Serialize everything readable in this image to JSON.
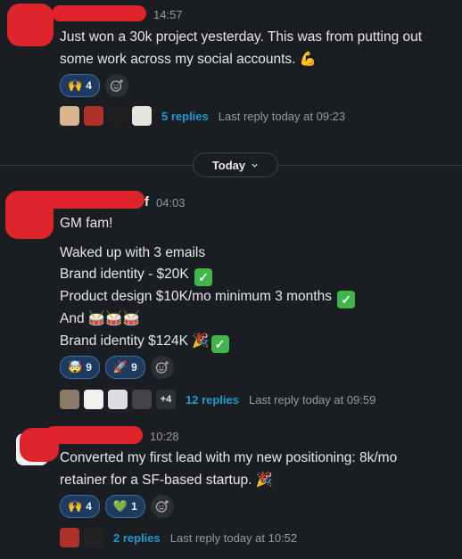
{
  "messages": [
    {
      "time": "14:57",
      "lines": [
        "Just won a 30k project yesterday. This was from putting out",
        "some work across my social accounts."
      ],
      "reactions": [
        {
          "emoji": "🙌",
          "count": "4"
        }
      ],
      "thread": {
        "replies": "5 replies",
        "last": "Last reply today at 09:23"
      }
    },
    {
      "name_fragment": "f",
      "time": "04:03",
      "lines": [
        "GM fam!",
        "",
        "Waked up with 3 emails",
        "Brand identity - $20K",
        "Product design $10K/mo minimum 3 months",
        "And",
        "Brand identity $124K"
      ],
      "reactions": [
        {
          "emoji": "🤯",
          "count": "9"
        },
        {
          "emoji": "🚀",
          "count": "9"
        }
      ],
      "thread": {
        "more": "+4",
        "replies": "12 replies",
        "last": "Last reply today at 09:59"
      }
    },
    {
      "time": "10:28",
      "lines": [
        "Converted my first lead with my new positioning: 8k/mo",
        "retainer for a SF-based startup."
      ],
      "reactions": [
        {
          "emoji": "🙌",
          "count": "4"
        },
        {
          "emoji": "💚",
          "count": "1"
        }
      ],
      "thread": {
        "replies": "2 replies",
        "last": "Last reply today at 10:52"
      }
    }
  ],
  "day_divider": {
    "label": "Today"
  },
  "icons": {
    "add_reaction": "add-reaction-icon",
    "chevron": "chevron-down-icon"
  },
  "colors": {
    "background": "#1a1d21",
    "link": "#1d9bd1",
    "reaction_bg": "#1f3a5f",
    "redaction": "#e0242b"
  }
}
